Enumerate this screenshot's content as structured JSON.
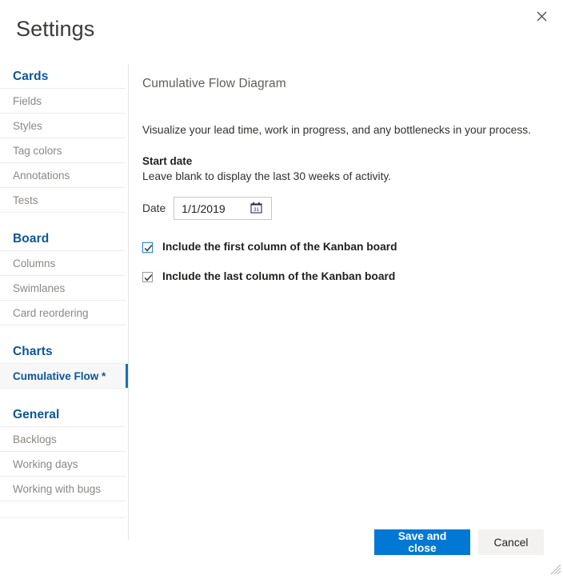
{
  "dialog": {
    "title": "Settings",
    "close_icon": "close-x-icon",
    "resize_grip_icon": "resize-grip-icon"
  },
  "sidebar": {
    "groups": [
      {
        "header": "Cards",
        "items": [
          {
            "label": "Fields",
            "selected": false
          },
          {
            "label": "Styles",
            "selected": false
          },
          {
            "label": "Tag colors",
            "selected": false
          },
          {
            "label": "Annotations",
            "selected": false
          },
          {
            "label": "Tests",
            "selected": false
          }
        ]
      },
      {
        "header": "Board",
        "items": [
          {
            "label": "Columns",
            "selected": false
          },
          {
            "label": "Swimlanes",
            "selected": false
          },
          {
            "label": "Card reordering",
            "selected": false
          }
        ]
      },
      {
        "header": "Charts",
        "items": [
          {
            "label": "Cumulative Flow *",
            "selected": true
          }
        ]
      },
      {
        "header": "General",
        "items": [
          {
            "label": "Backlogs",
            "selected": false
          },
          {
            "label": "Working days",
            "selected": false
          },
          {
            "label": "Working with bugs",
            "selected": false
          }
        ]
      }
    ]
  },
  "main": {
    "pane_title": "Cumulative Flow Diagram",
    "description": "Visualize your lead time, work in progress, and any bottlenecks in your process.",
    "start_date_label": "Start date",
    "start_date_hint": "Leave blank to display the last 30 weeks of activity.",
    "date_field_label": "Date",
    "date_value": "1/1/2019",
    "date_placeholder": "Enter a date",
    "calendar_icon": "calendar-icon",
    "calendar_icon_day": "31",
    "checkboxes": [
      {
        "label": "Include the first column of the Kanban board",
        "checked": true,
        "focused": true
      },
      {
        "label": "Include the last column of the Kanban board",
        "checked": true,
        "focused": false
      }
    ]
  },
  "footer": {
    "save_label": "Save and close",
    "cancel_label": "Cancel"
  },
  "colors": {
    "accent_blue": "#0078d4",
    "nav_header_blue": "#0a5699",
    "selection_bar": "#1570bd",
    "muted_text": "#8a8886",
    "body_text": "#323130",
    "border": "#ebebeb"
  }
}
